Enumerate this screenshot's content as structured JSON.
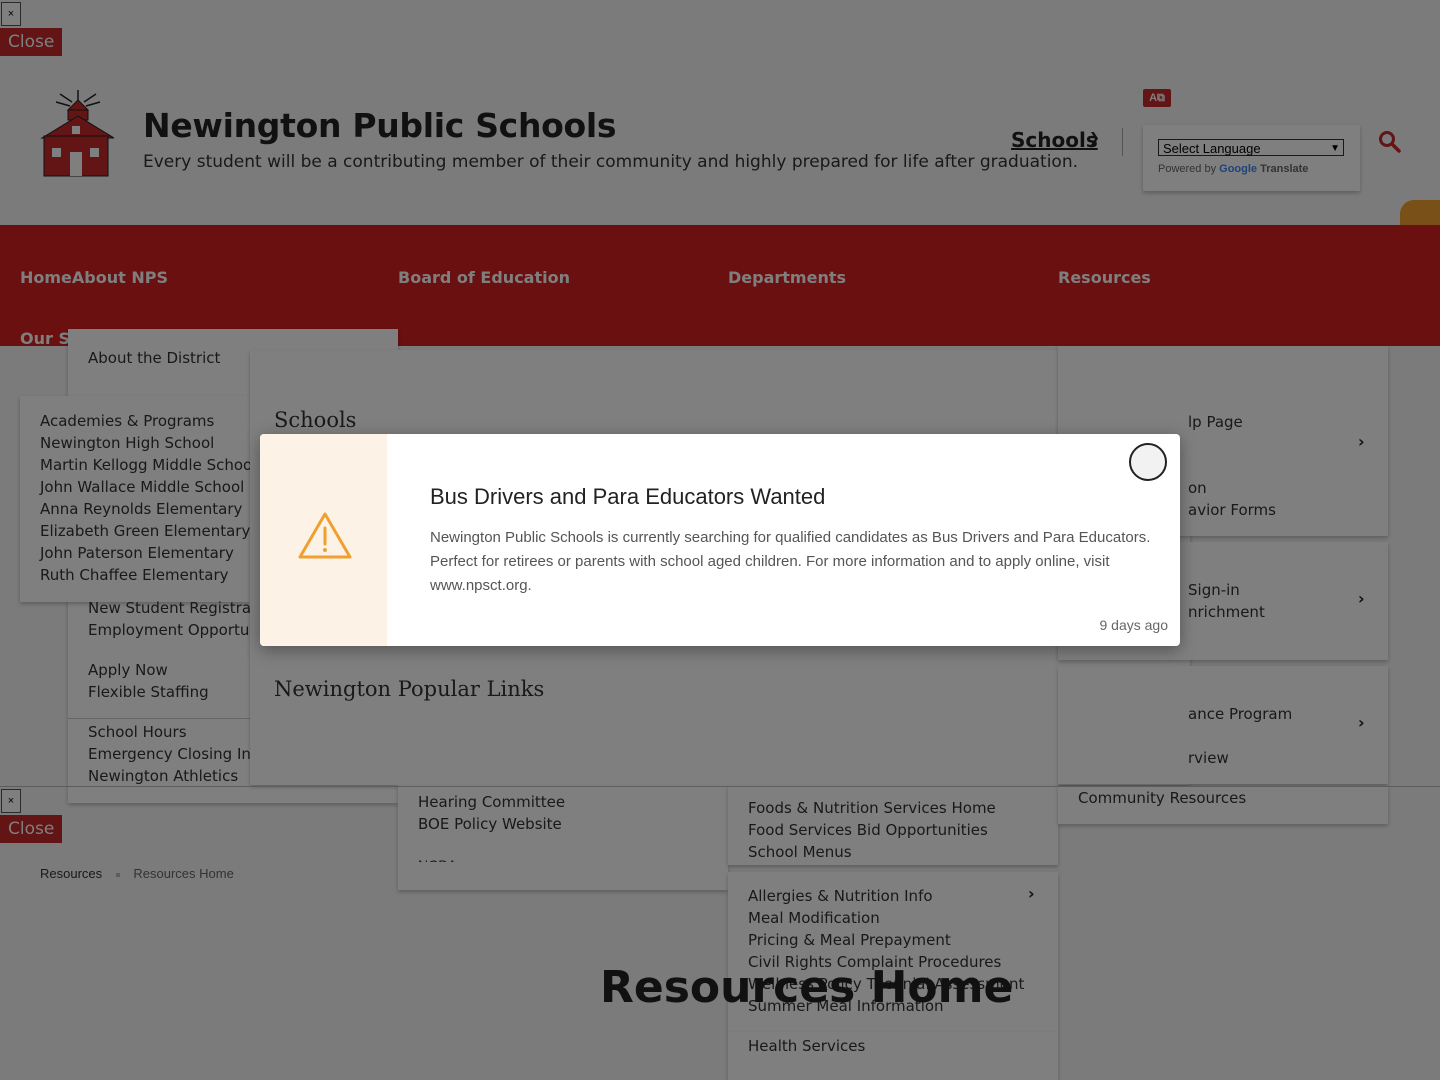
{
  "top_controls": {
    "x_label": "×",
    "close_label": "Close"
  },
  "bottom_controls": {
    "x_label": "×",
    "close_label": "Close"
  },
  "header": {
    "title": "Newington Public Schools",
    "tagline": "Every student will be a contributing member of their community and highly prepared for life after graduation.",
    "schools_link": "Schools",
    "translate": {
      "select_label": "Select Language",
      "powered_by": "Powered by",
      "google": "Google",
      "translate": "Translate"
    }
  },
  "nav": {
    "items": [
      "HomeAbout NPS",
      "Board of Education",
      "Departments",
      "Resources"
    ],
    "partial": "Our Sc"
  },
  "about_menu": {
    "items": [
      "About the District"
    ]
  },
  "schools_menu": {
    "items": [
      "Academies & Programs",
      "Newington High School",
      "Martin Kellogg Middle School",
      "John Wallace Middle School",
      "Anna Reynolds Elementary",
      "Elizabeth Green Elementary",
      "John Paterson Elementary",
      "Ruth Chaffee Elementary"
    ]
  },
  "about_menu_lower": {
    "items1": [
      "New Student Registratio",
      "Employment Opportuni"
    ],
    "items2": [
      "Apply Now",
      "Flexible Staffing"
    ],
    "items3": [
      "School Hours",
      "Emergency Closing Info",
      "Newington Athletics"
    ]
  },
  "mega": {
    "schools_heading": "Schools",
    "popular_heading": "Newington Popular Links"
  },
  "board_menu": {
    "items": [
      "Hearing Committee",
      "BOE Policy Website"
    ],
    "partial": "NCBA"
  },
  "dept_menu": {
    "group1": [
      "Foods & Nutrition Services Home",
      "Food Services Bid Opportunities",
      "School Menus"
    ],
    "group2": [
      "Allergies & Nutrition Info",
      "Meal Modification",
      "Pricing & Meal Prepayment",
      "Civil Rights Complaint Procedures",
      "Wellness Policy Triennial Assessment",
      "Summer Meal Information"
    ],
    "group3": [
      "Health Services"
    ]
  },
  "resources_menu": {
    "group1": [
      "lp Page",
      "on",
      "avior Forms"
    ],
    "group2": [
      "Sign-in",
      "nrichment"
    ],
    "group3": [
      "ance Program",
      "rview"
    ],
    "group4": [
      "Community Resources"
    ]
  },
  "breadcrumb": {
    "items": [
      "Resources",
      "Resources Home"
    ]
  },
  "page": {
    "heading": "Resources Home"
  },
  "modal": {
    "title": "Bus Drivers and Para Educators Wanted",
    "body": "Newington Public Schools is currently searching for qualified candidates as Bus Drivers and Para Educators. Perfect for retirees or parents with school aged children. For more information and to apply online, visit www.npsct.org.",
    "date": "9 days ago"
  },
  "colors": {
    "brand_red": "#d42020",
    "warning_orange": "#f0a030",
    "overlay": "rgba(0,0,0,0.5)"
  }
}
